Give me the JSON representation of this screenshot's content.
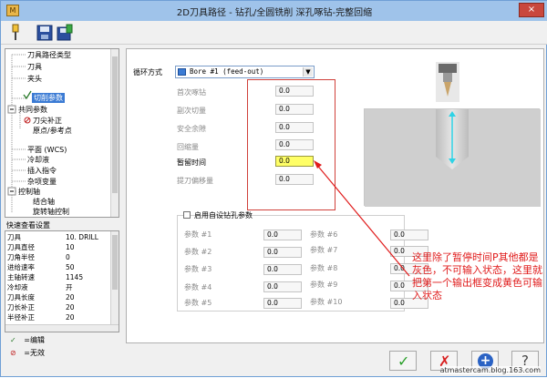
{
  "window": {
    "title": "2D刀具路径 - 钻孔/全圆铣削 深孔啄钻-完整回缩",
    "close_label": "×"
  },
  "tree": {
    "items": [
      "刀具路径类型",
      "刀具",
      "夹头",
      "切削参数",
      "共同参数",
      "刀尖补正",
      "原点/参考点",
      "平面 (WCS)",
      "冷却液",
      "插入指令",
      "杂项变量",
      "控制轴",
      "结合轴",
      "旋转轴控制"
    ],
    "selected": "切削参数"
  },
  "quick_view": {
    "title": "快速查看设置",
    "rows": [
      {
        "label": "刀具",
        "value": "10. DRILL"
      },
      {
        "label": "刀具直径",
        "value": "10"
      },
      {
        "label": "刀角半径",
        "value": "0"
      },
      {
        "label": "进给速率",
        "value": "50"
      },
      {
        "label": "主轴转速",
        "value": "1145"
      },
      {
        "label": "冷却液",
        "value": "开"
      },
      {
        "label": "刀具长度",
        "value": "20"
      },
      {
        "label": "刀长补正",
        "value": "20"
      },
      {
        "label": "半径补正",
        "value": "20"
      }
    ],
    "legend_edit": "=编辑",
    "legend_invalid": "=无效",
    "legend_edit_mark": "✓",
    "legend_invalid_mark": "⊘"
  },
  "main": {
    "cycle_label": "循环方式",
    "cycle_value": "Bore #1 (feed-out)",
    "fields": [
      {
        "label": "首次啄钻",
        "value": "0.0",
        "enabled": false
      },
      {
        "label": "副次切量",
        "value": "0.0",
        "enabled": false
      },
      {
        "label": "安全余隙",
        "value": "0.0",
        "enabled": false
      },
      {
        "label": "回缩量",
        "value": "0.0",
        "enabled": false
      },
      {
        "label": "暂留时间",
        "value": "0.0",
        "enabled": true
      },
      {
        "label": "提刀偏移量",
        "value": "0.0",
        "enabled": false
      }
    ],
    "custom_checkbox_label": "启用自设钻孔参数",
    "custom_params_left": [
      {
        "label": "参数 #1",
        "value": "0.0"
      },
      {
        "label": "参数 #2",
        "value": "0.0"
      },
      {
        "label": "参数 #3",
        "value": "0.0"
      },
      {
        "label": "参数 #4",
        "value": "0.0"
      },
      {
        "label": "参数 #5",
        "value": "0.0"
      }
    ],
    "custom_params_right": [
      {
        "label": "参数 #6",
        "value": "0.0"
      },
      {
        "label": "参数 #7",
        "value": "0.0"
      },
      {
        "label": "参数 #8",
        "value": "0.0"
      },
      {
        "label": "参数 #9",
        "value": "0.0"
      },
      {
        "label": "参数 #10",
        "value": "0.0"
      }
    ]
  },
  "annotation": "这里除了暂停时间P其他都是灰色，不可输入状态，这里就把第一个输出框变成黄色可输入状态",
  "buttons": {
    "ok": "✓",
    "cancel": "✗",
    "add": "+",
    "help": "?"
  },
  "watermark": "atmastercam.blog.163.com",
  "colors": {
    "accent": "#3b7bd4",
    "highlight_field": "#ffff66",
    "annotation_red": "#e01b1b",
    "arrow_cyan": "#2ed3e6"
  }
}
